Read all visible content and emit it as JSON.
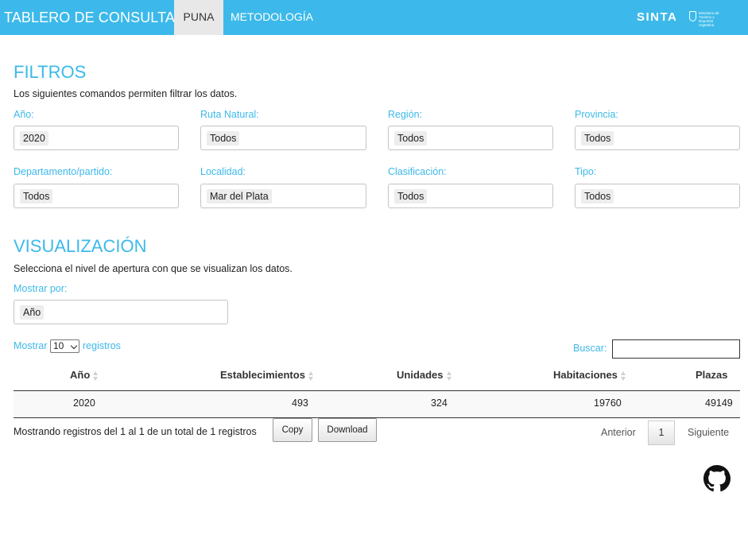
{
  "navbar": {
    "brand": "TABLERO DE CONSULTAS",
    "tabs": [
      {
        "label": "PUNA",
        "active": true
      },
      {
        "label": "METODOLOGÍA",
        "active": false
      }
    ],
    "sinta_logo": "SINTA",
    "ministry_logo_text": "Ministerio de Turismo y Deportes Argentina",
    "bg_color": "#3cb9ea"
  },
  "filters": {
    "title": "FILTROS",
    "description": "Los siguientes comandos permiten filtrar los datos.",
    "fields": [
      {
        "label": "Año:",
        "value": "2020"
      },
      {
        "label": "Ruta Natural:",
        "value": "Todos"
      },
      {
        "label": "Región:",
        "value": "Todos"
      },
      {
        "label": "Provincia:",
        "value": "Todos"
      },
      {
        "label": "Departamento/partido:",
        "value": "Todos"
      },
      {
        "label": "Localidad:",
        "value": "Mar del Plata"
      },
      {
        "label": "Clasificación:",
        "value": "Todos"
      },
      {
        "label": "Tipo:",
        "value": "Todos"
      }
    ]
  },
  "visualization": {
    "title": "VISUALIZACIÓN",
    "description": "Selecciona el nivel de apertura con que se visualizan los datos.",
    "show_by_label": "Mostrar por:",
    "show_by_value": "Año"
  },
  "table": {
    "length_label_before": "Mostrar",
    "length_value": "10",
    "length_label_after": "registros",
    "search_label": "Buscar:",
    "search_value": "",
    "columns": [
      "Año",
      "Establecimientos",
      "Unidades",
      "Habitaciones",
      "Plazas"
    ],
    "rows": [
      [
        "2020",
        "493",
        "324",
        "19760",
        "49149"
      ]
    ],
    "info": "Mostrando registros del 1 al 1 de un total de 1 registros",
    "copy_label": "Copy",
    "download_label": "Download",
    "pagination": {
      "previous": "Anterior",
      "current": "1",
      "next": "Siguiente"
    }
  },
  "footer": {
    "icon": "github-icon"
  }
}
